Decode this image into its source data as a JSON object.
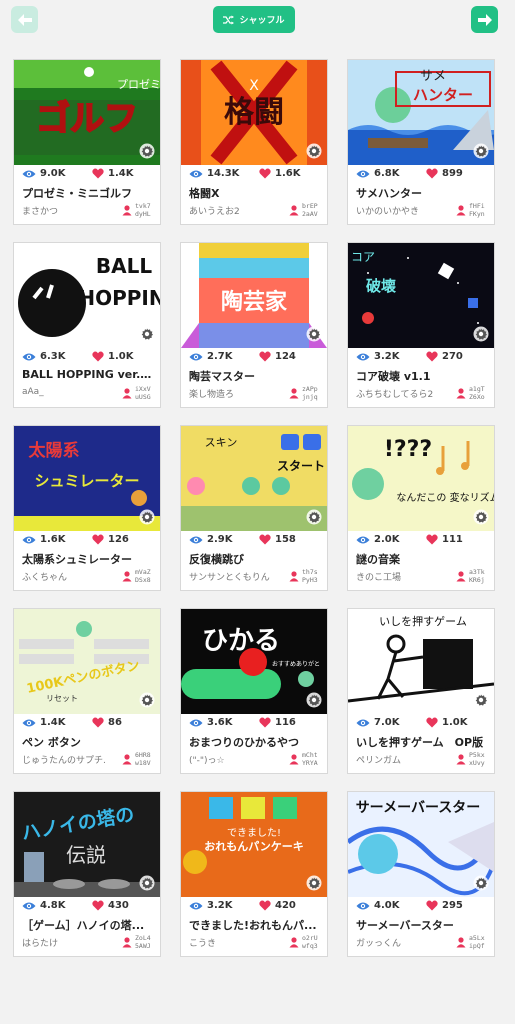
{
  "toolbar": {
    "back_icon": "arrow-left-icon",
    "next_icon": "arrow-right-icon",
    "shuffle_icon": "shuffle-icon",
    "shuffle_label": "シャッフル"
  },
  "colors": {
    "accent": "#21c085",
    "heart": "#e8355a",
    "eye": "#3b7fd9",
    "background": "#f2f2f2"
  },
  "cards": [
    {
      "views": "9.0K",
      "likes": "1.4K",
      "title": "プロゼミ・ミニゴルフ",
      "author": "まさかつ",
      "uid1": "tvk7",
      "uid2": "dyHL",
      "thumb_text": "ゴルフ",
      "thumb_sub": "プロゼミ"
    },
    {
      "views": "14.3K",
      "likes": "1.6K",
      "title": "格闘X",
      "author": "あいうえお2",
      "uid1": "brEP",
      "uid2": "2aAV",
      "thumb_text": "格闘",
      "thumb_sub": "X"
    },
    {
      "views": "6.8K",
      "likes": "899",
      "title": "サメハンター",
      "author": "いかのいかやき",
      "uid1": "fHFi",
      "uid2": "FKyn",
      "thumb_text": "ハンター",
      "thumb_sub": "サメ"
    },
    {
      "views": "6.3K",
      "likes": "1.0K",
      "title": "BALL HOPPING ver.fi...",
      "author": "aAa_",
      "uid1": "iXxV",
      "uid2": "uUSG",
      "thumb_text": "HOPPIN",
      "thumb_sub": "BALL"
    },
    {
      "views": "2.7K",
      "likes": "124",
      "title": "陶芸マスター",
      "author": "楽し物造ろ",
      "uid1": "zAPp",
      "uid2": "jnjq",
      "thumb_text": "陶芸家",
      "thumb_sub": ""
    },
    {
      "views": "3.2K",
      "likes": "270",
      "title": "コア破壊 v1.1",
      "author": "ふちちむしてるら2",
      "uid1": "a1gT",
      "uid2": "Z6Xo",
      "thumb_text": "破壊",
      "thumb_sub": "コア"
    },
    {
      "views": "1.6K",
      "likes": "126",
      "title": "太陽系シュミレーター",
      "author": "ふくちゃん",
      "uid1": "mVaZ",
      "uid2": "DSx8",
      "thumb_text": "シュミレーター",
      "thumb_sub": "太陽系"
    },
    {
      "views": "2.9K",
      "likes": "158",
      "title": "反復横跳び",
      "author": "サンサンとくもりん",
      "uid1": "th7s",
      "uid2": "PyH3",
      "thumb_text": "スタート",
      "thumb_sub": "スキン"
    },
    {
      "views": "2.0K",
      "likes": "111",
      "title": "謎の音楽",
      "author": "きのこ工場",
      "uid1": "a3Tk",
      "uid2": "KR6j",
      "thumb_text": "!???",
      "thumb_sub": "なんだこの 変なリズム"
    },
    {
      "views": "1.4K",
      "likes": "86",
      "title": "ペン ボタン",
      "author": "じゅうたんのサプチ.",
      "uid1": "6HR8",
      "uid2": "w18V",
      "thumb_text": "100Kペンのボタン",
      "thumb_sub": "リセット"
    },
    {
      "views": "3.6K",
      "likes": "116",
      "title": "おまつりのひかるやつ",
      "author": "(\"-\")っ☆",
      "uid1": "mCht",
      "uid2": "YRYA",
      "thumb_text": "ひかる",
      "thumb_sub": "おすすめありがと"
    },
    {
      "views": "7.0K",
      "likes": "1.0K",
      "title": "いしを押すゲーム　OP版",
      "author": "ペリンガム",
      "uid1": "P5kx",
      "uid2": "xUvy",
      "thumb_text": "いしを押すゲーム",
      "thumb_sub": ""
    },
    {
      "views": "4.8K",
      "likes": "430",
      "title": "［ゲーム］ハノイの塔...",
      "author": "はらたけ",
      "uid1": "ZoL4",
      "uid2": "5AWJ",
      "thumb_text": "ハノイの塔の",
      "thumb_sub": "伝説"
    },
    {
      "views": "3.2K",
      "likes": "420",
      "title": "できました!おれもんパ...",
      "author": "こうき",
      "uid1": "o2rU",
      "uid2": "wfq3",
      "thumb_text": "おれもんパンケーキ",
      "thumb_sub": "できました!"
    },
    {
      "views": "4.0K",
      "likes": "295",
      "title": "サーメーバースター",
      "author": "ガッっくん",
      "uid1": "a5Lx",
      "uid2": "ipQf",
      "thumb_text": "サーメーバースター",
      "thumb_sub": ""
    }
  ]
}
